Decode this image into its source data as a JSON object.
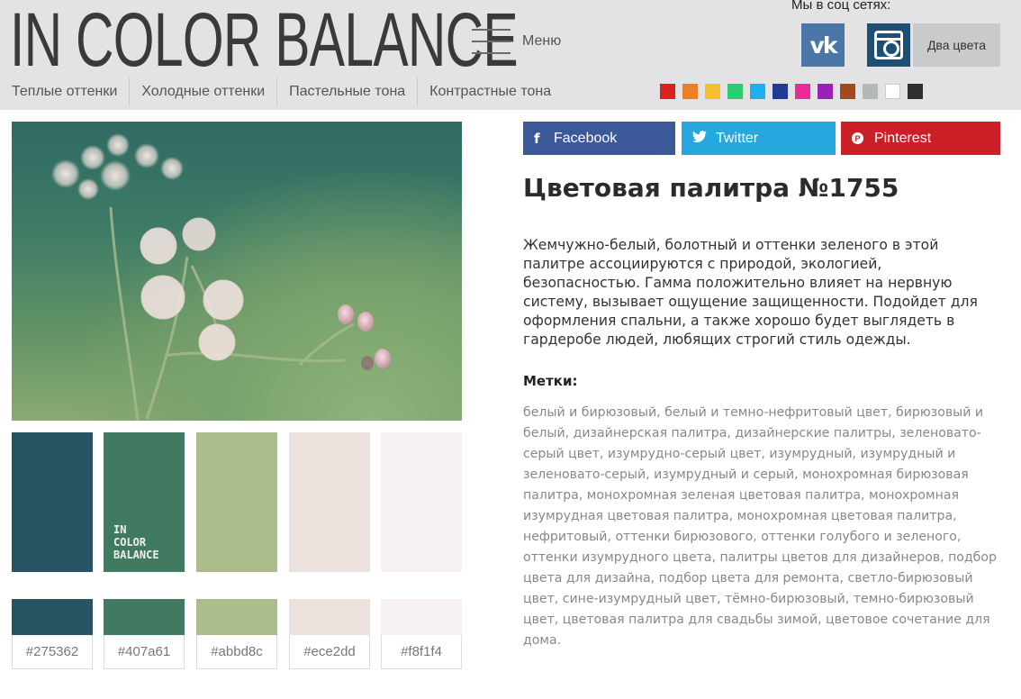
{
  "header": {
    "logo": "IN COLOR BALANCE",
    "menu_label": "Меню",
    "social_label": "Мы в соц сетях:",
    "vk_label": "vk",
    "two_colors_label": "Два цвета",
    "nav": [
      "Теплые оттенки",
      "Холодные оттенки",
      "Пастельные тона",
      "Контрастные тона"
    ],
    "color_filters": [
      "#d92121",
      "#e9802a",
      "#f4c030",
      "#2ecc71",
      "#1cb0f0",
      "#213a96",
      "#ea2b9a",
      "#9b1fb8",
      "#a04a22",
      "#b4b8b8",
      "#ffffff",
      "#2f2f2f"
    ]
  },
  "palette": {
    "colors": [
      {
        "hex": "#275362",
        "label": "#275362"
      },
      {
        "hex": "#407a61",
        "label": "#407a61"
      },
      {
        "hex": "#abbd8c",
        "label": "#abbd8c"
      },
      {
        "hex": "#ece2dd",
        "label": "#ece2dd"
      },
      {
        "hex": "#f8f1f4",
        "label": "#f8f1f4"
      }
    ],
    "watermark": "IN\nCOLOR\nBALANCE"
  },
  "share": {
    "facebook": "Facebook",
    "twitter": "Twitter",
    "pinterest": "Pinterest"
  },
  "article": {
    "title": "Цветовая палитра №1755",
    "description": "Жемчужно-белый, болотный и оттенки зеленого в этой палитре ассоциируются с природой, экологией, безопасностью. Гамма положительно влияет на нервную систему, вызывает ощущение защищенности. Подойдет для оформления спальни, а также хорошо будет выглядеть в гардеробе людей, любящих строгий стиль одежды.",
    "tags_label": "Метки:",
    "tags": [
      "белый и бирюзовый",
      "белый и темно-нефритовый цвет",
      "бирюзовый и белый",
      "дизайнерская палитра",
      "дизайнерские палитры",
      "зеленовато-серый цвет",
      "изумрудно-серый цвет",
      "изумрудный",
      "изумрудный и зеленовато-серый",
      "изумрудный и серый",
      "монохромная бирюзовая палитра",
      "монохромная зеленая цветовая палитра",
      "монохромная изумрудная цветовая палитра",
      "монохромная цветовая палитра",
      "нефритовый",
      "оттенки бирюзового",
      "оттенки голубого и зеленого",
      "оттенки изумрудного цвета",
      "палитры цветов для дизайнеров",
      "подбор цвета для дизайна",
      "подбор цвета для ремонта",
      "светло-бирюзовый цвет",
      "сине-изумрудный цвет",
      "тёмно-бирюзовый",
      "темно-бирюзовый цвет",
      "цветовая палитра для свадьбы зимой",
      "цветовое сочетание для дома."
    ]
  }
}
